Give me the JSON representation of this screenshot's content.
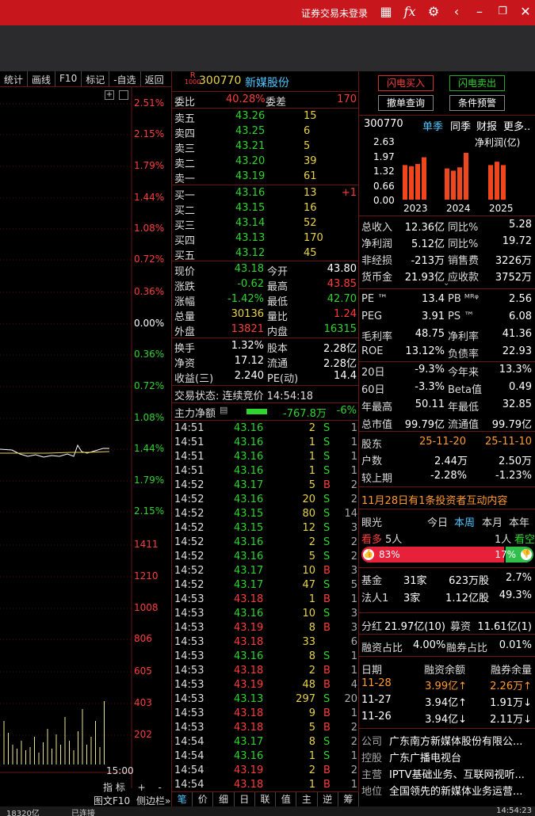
{
  "titlebar": {
    "login": "证券交易未登录",
    "icons": [
      "grid-icon",
      "fx-icon",
      "gear-icon",
      "back-icon",
      "restore-icon",
      "close-icon"
    ]
  },
  "toolbar": [
    "统计",
    "画线",
    "F10",
    "标记",
    "-自选",
    "返回"
  ],
  "chart": {
    "pct_labels": [
      "2.51%",
      "2.15%",
      "1.79%",
      "1.44%",
      "1.08%",
      "0.72%",
      "0.36%",
      "0.00%",
      "0.36%",
      "0.72%",
      "1.08%",
      "1.44%",
      "1.79%",
      "2.15%"
    ],
    "vol_labels": [
      "1411",
      "1210",
      "1008",
      "806",
      "605",
      "403",
      "202"
    ],
    "time_end": "15:00",
    "bottom_btns": [
      "指 标",
      "+",
      "-"
    ],
    "bottom2": [
      "图文F10",
      "侧边栏»"
    ]
  },
  "stock": {
    "code": "300770",
    "name": "新媒股份",
    "badge_top": "R",
    "badge_bottom": "1000"
  },
  "weibi": {
    "label": "委比",
    "value": "40.28%",
    "diff_label": "委差",
    "diff": "170"
  },
  "asks": [
    {
      "l": "卖五",
      "p": "43.26",
      "v": "15"
    },
    {
      "l": "卖四",
      "p": "43.25",
      "v": "6"
    },
    {
      "l": "卖三",
      "p": "43.21",
      "v": "5"
    },
    {
      "l": "卖二",
      "p": "43.20",
      "v": "39"
    },
    {
      "l": "卖一",
      "p": "43.19",
      "v": "61"
    }
  ],
  "bids": [
    {
      "l": "买一",
      "p": "43.16",
      "v": "13",
      "x": "+1"
    },
    {
      "l": "买二",
      "p": "43.15",
      "v": "16",
      "x": ""
    },
    {
      "l": "买三",
      "p": "43.14",
      "v": "52",
      "x": ""
    },
    {
      "l": "买四",
      "p": "43.13",
      "v": "170",
      "x": ""
    },
    {
      "l": "买五",
      "p": "43.12",
      "v": "45",
      "x": ""
    }
  ],
  "quote": [
    {
      "a": "现价",
      "av": "43.18",
      "b": "今开",
      "bv": "43.80"
    },
    {
      "a": "涨跌",
      "av": "-0.62",
      "b": "最高",
      "bv": "43.85"
    },
    {
      "a": "涨幅",
      "av": "-1.42%",
      "b": "最低",
      "bv": "42.70"
    },
    {
      "a": "总量",
      "av": "30136",
      "b": "量比",
      "bv": "1.24"
    },
    {
      "a": "外盘",
      "av": "13821",
      "b": "内盘",
      "bv": "16315"
    }
  ],
  "quote2": [
    {
      "a": "换手",
      "av": "1.32%",
      "b": "股本",
      "bv": "2.28亿"
    },
    {
      "a": "净资",
      "av": "17.12",
      "b": "流通",
      "bv": "2.28亿"
    },
    {
      "a": "收益(三)",
      "av": "2.240",
      "b": "PE(动)",
      "bv": "14.4"
    }
  ],
  "status": "交易状态: 连续竞价 14:54:18",
  "flow": {
    "label": "主力净额",
    "value": "-767.8万",
    "pct": "-6%"
  },
  "ticks": [
    [
      "14:51",
      "43.16",
      "2",
      "S",
      "1"
    ],
    [
      "14:51",
      "43.16",
      "1",
      "S",
      "1"
    ],
    [
      "14:51",
      "43.16",
      "1",
      "S",
      "1"
    ],
    [
      "14:51",
      "43.16",
      "1",
      "S",
      "1"
    ],
    [
      "14:52",
      "43.17",
      "5",
      "B",
      "2"
    ],
    [
      "14:52",
      "43.16",
      "20",
      "S",
      "2"
    ],
    [
      "14:52",
      "43.15",
      "80",
      "S",
      "14"
    ],
    [
      "14:52",
      "43.15",
      "12",
      "S",
      "3"
    ],
    [
      "14:52",
      "43.16",
      "2",
      "S",
      "2"
    ],
    [
      "14:52",
      "43.16",
      "5",
      "S",
      "2"
    ],
    [
      "14:52",
      "43.17",
      "10",
      "B",
      "3"
    ],
    [
      "14:52",
      "43.17",
      "47",
      "S",
      "5"
    ],
    [
      "14:53",
      "43.18",
      "1",
      "B",
      "1"
    ],
    [
      "14:53",
      "43.16",
      "10",
      "S",
      "3"
    ],
    [
      "14:53",
      "43.19",
      "8",
      "B",
      "3"
    ],
    [
      "14:53",
      "43.18",
      "33",
      "",
      "6"
    ],
    [
      "14:53",
      "43.16",
      "8",
      "S",
      "1"
    ],
    [
      "14:53",
      "43.18",
      "2",
      "B",
      "1"
    ],
    [
      "14:53",
      "43.19",
      "48",
      "B",
      "4"
    ],
    [
      "14:53",
      "43.13",
      "297",
      "S",
      "20"
    ],
    [
      "14:53",
      "43.18",
      "9",
      "B",
      "1"
    ],
    [
      "14:53",
      "43.18",
      "5",
      "B",
      "2"
    ],
    [
      "14:54",
      "43.17",
      "8",
      "S",
      "2"
    ],
    [
      "14:54",
      "43.16",
      "1",
      "S",
      "1"
    ],
    [
      "14:54",
      "43.19",
      "2",
      "B",
      "2"
    ],
    [
      "14:54",
      "43.18",
      "1",
      "B",
      "1"
    ]
  ],
  "bottom_tabs": [
    "笔",
    "价",
    "细",
    "日",
    "联",
    "值",
    "主",
    "逆",
    "筹"
  ],
  "right": {
    "btn_buy": "闪电买入",
    "btn_sell": "闪电卖出",
    "btn_cancel": "撤单查询",
    "btn_cond": "条件预警",
    "code": "300770",
    "tabs": [
      "单季",
      "同季",
      "财报",
      "更多.."
    ],
    "profit_label": "净利润(亿)",
    "bars": {
      "yticks": [
        "2.63",
        "1.97",
        "1.32",
        "0.66",
        "0.00"
      ],
      "years": [
        "2023",
        "2024",
        "2025"
      ],
      "values": [
        1.55,
        1.5,
        1.6,
        1.9,
        1.4,
        1.3,
        1.45,
        2.1,
        1.55,
        1.7,
        1.55
      ]
    },
    "fin": [
      {
        "a": "总收入",
        "av": "12.36亿",
        "b": "同比%",
        "bv": "5.28"
      },
      {
        "a": "净利润",
        "av": "5.12亿",
        "b": "同比%",
        "bv": "19.72"
      },
      {
        "a": "非经损",
        "av": "-213万",
        "b": "销售费",
        "bv": "3226万"
      },
      {
        "a": "货币金",
        "av": "21.93亿",
        "b": "应收款",
        "bv": "3752万"
      }
    ],
    "val": [
      {
        "a": "PE ™",
        "av": "13.4",
        "b": "PB ᴹᴿᵠ",
        "bv": "2.56"
      },
      {
        "a": "PEG",
        "av": "3.91",
        "b": "PS ™",
        "bv": "6.08"
      },
      {
        "a": "毛利率",
        "av": "48.75",
        "b": "净利率",
        "bv": "41.36"
      },
      {
        "a": "ROE",
        "av": "13.12%",
        "b": "负债率",
        "bv": "22.93"
      }
    ],
    "perf": [
      {
        "a": "20日",
        "av": "-9.3%",
        "b": "今年来",
        "bv": "13.3%"
      },
      {
        "a": "60日",
        "av": "-3.3%",
        "b": "Beta值",
        "bv": "0.49"
      },
      {
        "a": "年最高",
        "av": "50.11",
        "b": "年最低",
        "bv": "32.85"
      },
      {
        "a": "总市值",
        "av": "99.79亿",
        "b": "流通值",
        "bv": "99.79亿"
      }
    ],
    "holder": {
      "label": "股东",
      "d1": "25-11-20",
      "d2": "25-11-10",
      "r1": "户数",
      "r1a": "2.44万",
      "r1b": "2.50万",
      "r2": "较上期",
      "r2a": "-2.28%",
      "r2b": "-1.23%"
    },
    "notice": "11月28日有1条投资者互动内容",
    "eye": {
      "label": "眼光",
      "tabs": [
        "今日",
        "本周",
        "本月",
        "本年"
      ],
      "bull": "看多",
      "bull_n": "5人",
      "bear_n": "1人",
      "bear": "看空",
      "bull_pct": "83%",
      "bear_pct": "17%",
      "bull_frac": 0.83
    },
    "fund": [
      {
        "a": "基金",
        "b": "31家",
        "c": "623万股",
        "d": "2.7%"
      },
      {
        "a": "法人1",
        "b": "3家",
        "c": "1.12亿股",
        "d": "49.3%"
      }
    ],
    "div": {
      "a": "分红",
      "av": "21.97亿(10)",
      "b": "募资",
      "bv": "11.61亿(1)"
    },
    "margin": {
      "a": "融资占比",
      "av": "4.00%",
      "b": "融券占比",
      "bv": "0.01%"
    },
    "mtab": {
      "h1": "日期",
      "h2": "融资余额",
      "h3": "融券余量",
      "rows": [
        [
          "11-28",
          "3.99亿↑",
          "2.26万↑"
        ],
        [
          "11-27",
          "3.94亿↑",
          "1.91万↓"
        ],
        [
          "11-26",
          "3.94亿↓",
          "2.11万↓"
        ]
      ]
    },
    "info": [
      {
        "a": "公司",
        "b": "广东南方新媒体股份有限公..."
      },
      {
        "a": "控股",
        "b": "广东广播电视台"
      },
      {
        "a": "主营",
        "b": "IPTV基础业务、互联网视听..."
      },
      {
        "a": "地位",
        "b": "全国领先的新媒体业务运营..."
      }
    ]
  },
  "statusbar": {
    "left": "18320亿",
    "mid": "已连接",
    "time": "14:54:23"
  }
}
